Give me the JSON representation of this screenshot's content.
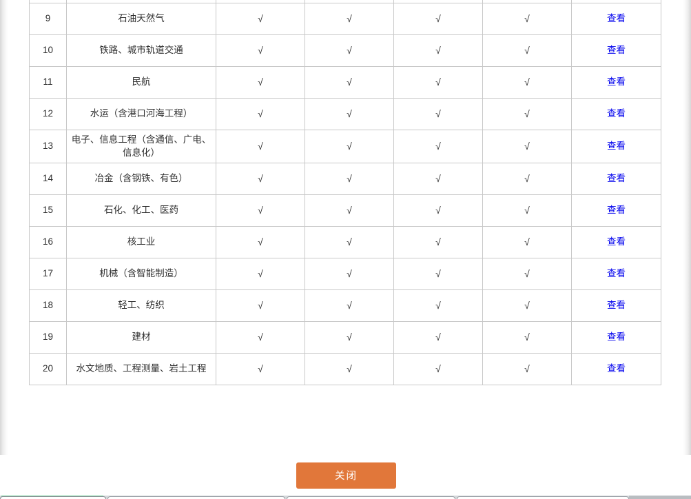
{
  "dialog": {
    "close_button_label": "关闭"
  },
  "table": {
    "view_link_label": "查看",
    "check_mark": "√",
    "rows": [
      {
        "index": "9",
        "name": "石油天然气",
        "c1": "√",
        "c2": "√",
        "c3": "√",
        "c4": "√",
        "action": "查看"
      },
      {
        "index": "10",
        "name": "铁路、城市轨道交通",
        "c1": "√",
        "c2": "√",
        "c3": "√",
        "c4": "√",
        "action": "查看"
      },
      {
        "index": "11",
        "name": "民航",
        "c1": "√",
        "c2": "√",
        "c3": "√",
        "c4": "√",
        "action": "查看"
      },
      {
        "index": "12",
        "name": "水运（含港口河海工程）",
        "c1": "√",
        "c2": "√",
        "c3": "√",
        "c4": "√",
        "action": "查看"
      },
      {
        "index": "13",
        "name": "电子、信息工程（含通信、广电、信息化）",
        "c1": "√",
        "c2": "√",
        "c3": "√",
        "c4": "√",
        "action": "查看"
      },
      {
        "index": "14",
        "name": "冶金（含钢铁、有色）",
        "c1": "√",
        "c2": "√",
        "c3": "√",
        "c4": "√",
        "action": "查看"
      },
      {
        "index": "15",
        "name": "石化、化工、医药",
        "c1": "√",
        "c2": "√",
        "c3": "√",
        "c4": "√",
        "action": "查看"
      },
      {
        "index": "16",
        "name": "核工业",
        "c1": "√",
        "c2": "√",
        "c3": "√",
        "c4": "√",
        "action": "查看"
      },
      {
        "index": "17",
        "name": "机械（含智能制造）",
        "c1": "√",
        "c2": "√",
        "c3": "√",
        "c4": "√",
        "action": "查看"
      },
      {
        "index": "18",
        "name": "轻工、纺织",
        "c1": "√",
        "c2": "√",
        "c3": "√",
        "c4": "√",
        "action": "查看"
      },
      {
        "index": "19",
        "name": "建材",
        "c1": "√",
        "c2": "√",
        "c3": "√",
        "c4": "√",
        "action": "查看"
      },
      {
        "index": "20",
        "name": "水文地质、工程测量、岩土工程",
        "c1": "√",
        "c2": "√",
        "c3": "√",
        "c4": "√",
        "action": "查看"
      }
    ]
  },
  "colors": {
    "link": "#0000ee",
    "close_button": "#e1773a",
    "table_border": "#c8c8c8",
    "text": "#2f2f2f"
  }
}
